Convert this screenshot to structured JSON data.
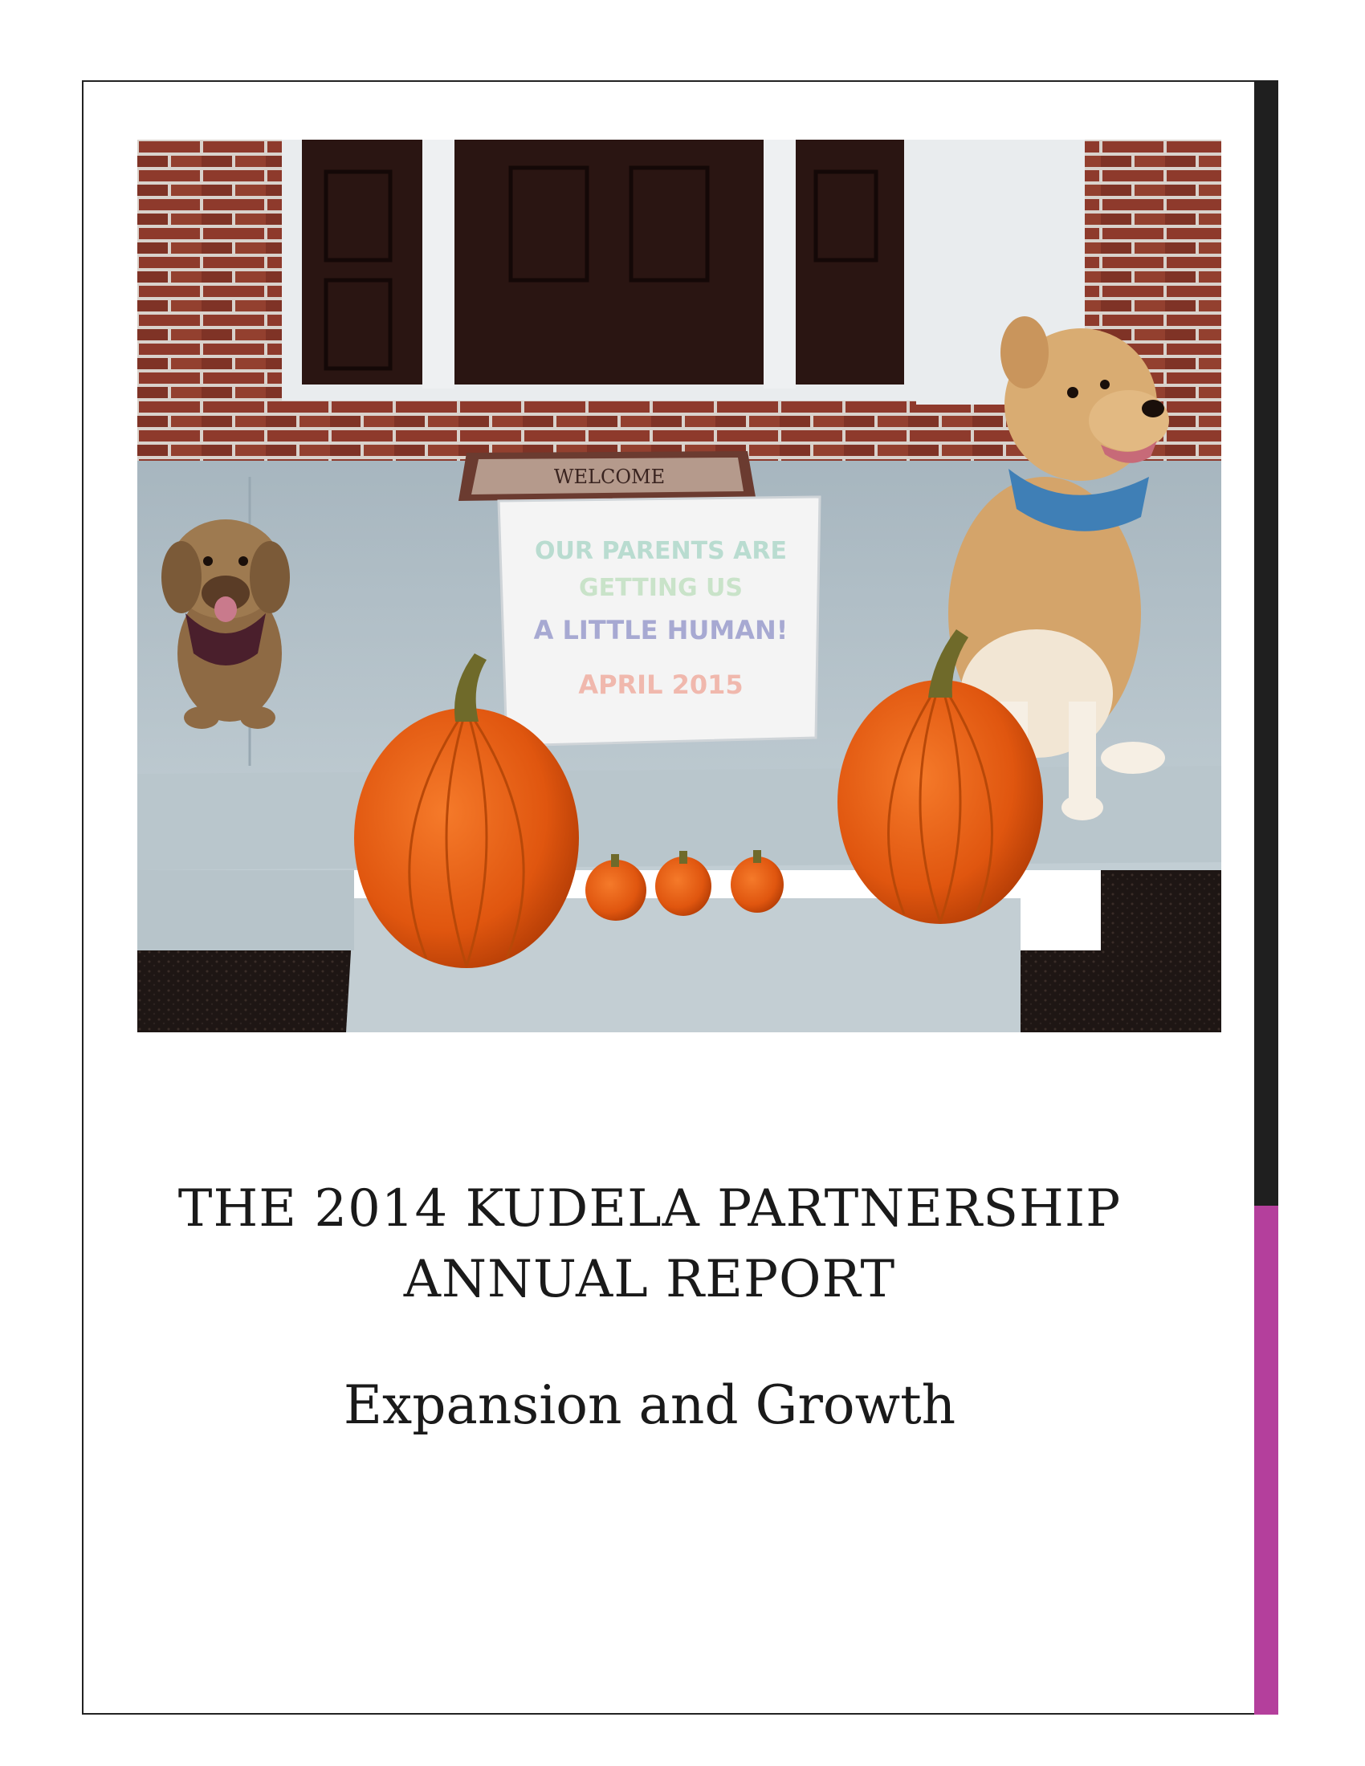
{
  "cover": {
    "title_line1": "THE 2014 KUDELA PARTNERSHIP",
    "title_line2": "ANNUAL REPORT",
    "subtitle": "Expansion and Growth"
  },
  "photo": {
    "sign_line1": "OUR PARENTS ARE",
    "sign_line2": "GETTING US",
    "sign_line3": "A LITTLE HUMAN!",
    "sign_line4": "APRIL 2015",
    "doormat_text": "WELCOME"
  },
  "colors": {
    "frame": "#222222",
    "spine_dark": "#1f1f1f",
    "spine_accent": "#b43f9c",
    "brick": "#8e3a2c",
    "door": "#2a1512",
    "concrete": "#b6c4cb",
    "pumpkin": "#e0560f"
  }
}
